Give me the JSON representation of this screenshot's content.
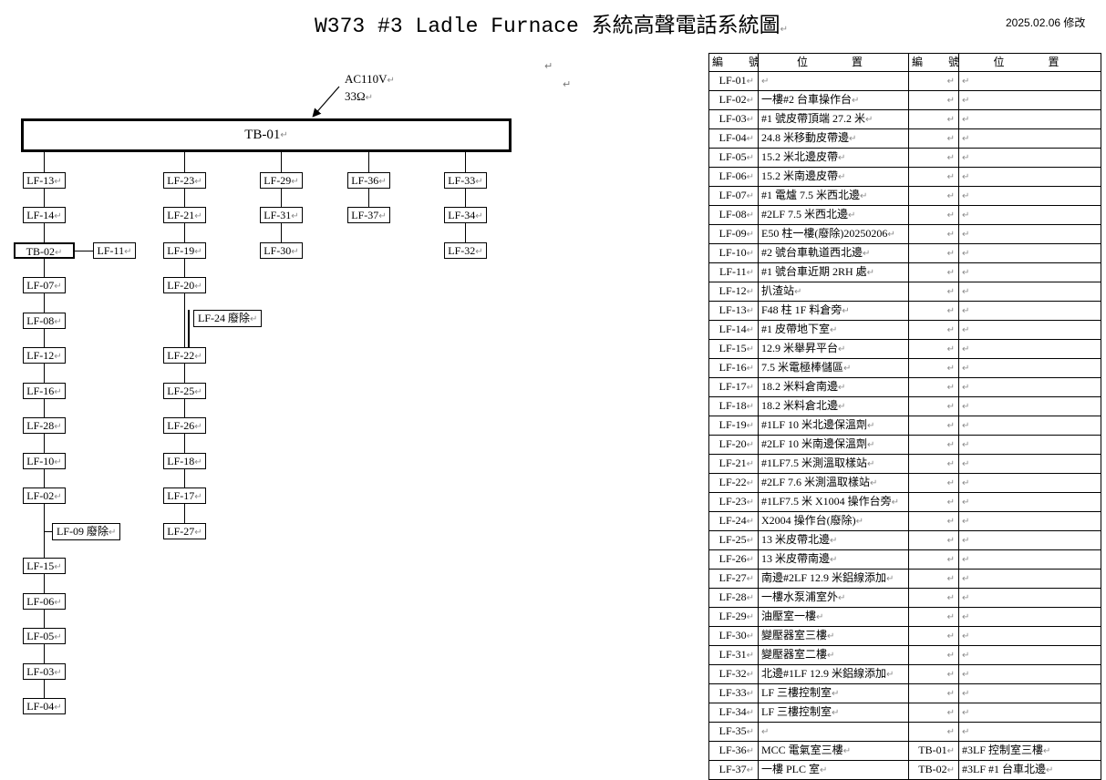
{
  "doc": {
    "title": "W373 #3 Ladle Furnace 系統高聲電話系統圖",
    "date": "2025.02.06 修改",
    "return_mark": "↵"
  },
  "diagram": {
    "power_label": "AC110V",
    "impedance_label": "33Ω",
    "main_box": "TB-01",
    "col1": [
      "LF-13",
      "LF-14",
      "TB-02",
      "LF-07",
      "LF-08",
      "LF-12",
      "LF-16",
      "LF-28",
      "LF-10",
      "LF-02",
      "LF-15",
      "LF-06",
      "LF-05",
      "LF-03",
      "LF-04"
    ],
    "col1_branch": "LF-11",
    "col1_note": "LF-09 廢除",
    "col2": [
      "LF-23",
      "LF-21",
      "LF-19",
      "LF-20",
      "LF-22",
      "LF-25",
      "LF-26",
      "LF-18",
      "LF-17",
      "LF-27"
    ],
    "col2_note": "LF-24 廢除",
    "col3": [
      "LF-29",
      "LF-31",
      "LF-30"
    ],
    "col4": [
      "LF-36",
      "LF-37"
    ],
    "col5": [
      "LF-33",
      "LF-34",
      "LF-32"
    ]
  },
  "table": {
    "headers": [
      "編　號",
      "位　　置",
      "編　號",
      "位　　置"
    ],
    "rows": [
      [
        "LF-01",
        "",
        "",
        ""
      ],
      [
        "LF-02",
        "一樓#2 台車操作台",
        "",
        ""
      ],
      [
        "LF-03",
        "#1 號皮帶頂端 27.2 米",
        "",
        ""
      ],
      [
        "LF-04",
        "24.8 米移動皮帶邊",
        "",
        ""
      ],
      [
        "LF-05",
        "15.2 米北邊皮帶",
        "",
        ""
      ],
      [
        "LF-06",
        "15.2 米南邊皮帶",
        "",
        ""
      ],
      [
        "LF-07",
        "#1 電爐 7.5 米西北邊",
        "",
        ""
      ],
      [
        "LF-08",
        "#2LF 7.5 米西北邊",
        "",
        ""
      ],
      [
        "LF-09",
        "E50 柱一樓(廢除)20250206",
        "",
        ""
      ],
      [
        "LF-10",
        "#2 號台車軌道西北邊",
        "",
        ""
      ],
      [
        "LF-11",
        "#1 號台車近期 2RH 處",
        "",
        ""
      ],
      [
        "LF-12",
        "扒渣站",
        "",
        ""
      ],
      [
        "LF-13",
        "F48 柱 1F 料倉旁",
        "",
        ""
      ],
      [
        "LF-14",
        "#1 皮帶地下室",
        "",
        ""
      ],
      [
        "LF-15",
        "12.9 米舉昇平台",
        "",
        ""
      ],
      [
        "LF-16",
        "7.5 米電極棒儲區",
        "",
        ""
      ],
      [
        "LF-17",
        "18.2 米料倉南邊",
        "",
        ""
      ],
      [
        "LF-18",
        "18.2 米料倉北邊",
        "",
        ""
      ],
      [
        "LF-19",
        "#1LF 10 米北邊保溫劑",
        "",
        ""
      ],
      [
        "LF-20",
        "#2LF 10 米南邊保溫劑",
        "",
        ""
      ],
      [
        "LF-21",
        "#1LF7.5 米測溫取樣站",
        "",
        ""
      ],
      [
        "LF-22",
        "#2LF 7.6 米測溫取樣站",
        "",
        ""
      ],
      [
        "LF-23",
        "#1LF7.5 米 X1004 操作台旁",
        "",
        ""
      ],
      [
        "LF-24",
        "X2004 操作台(廢除)",
        "",
        ""
      ],
      [
        "LF-25",
        "13 米皮帶北邊",
        "",
        ""
      ],
      [
        "LF-26",
        "13 米皮帶南邊",
        "",
        ""
      ],
      [
        "LF-27",
        "南邊#2LF 12.9 米鋁線添加",
        "",
        ""
      ],
      [
        "LF-28",
        "一樓水泵浦室外",
        "",
        ""
      ],
      [
        "LF-29",
        "油壓室一樓",
        "",
        ""
      ],
      [
        "LF-30",
        "變壓器室三樓",
        "",
        ""
      ],
      [
        "LF-31",
        "變壓器室二樓",
        "",
        ""
      ],
      [
        "LF-32",
        "北邊#1LF 12.9 米鋁線添加",
        "",
        ""
      ],
      [
        "LF-33",
        "LF 三樓控制室",
        "",
        ""
      ],
      [
        "LF-34",
        "LF 三樓控制室",
        "",
        ""
      ],
      [
        "LF-35",
        "",
        "",
        ""
      ],
      [
        "LF-36",
        "MCC 電氣室三樓",
        "TB-01",
        "#3LF 控制室三樓"
      ],
      [
        "LF-37",
        "一樓 PLC 室",
        "TB-02",
        "#3LF #1 台車北邊"
      ]
    ]
  }
}
